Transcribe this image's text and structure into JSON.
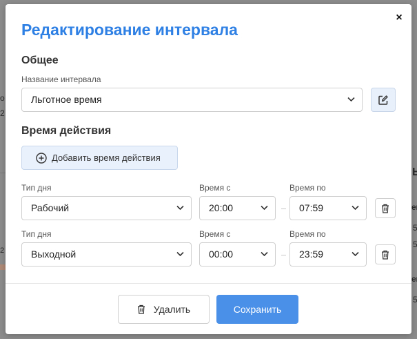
{
  "background": {
    "fragments": [
      "о",
      "2",
      "2",
      "Ь",
      "ем",
      "5",
      "5",
      "ем",
      "5"
    ]
  },
  "modal": {
    "title": "Редактирование интервала",
    "close_label": "×",
    "general": {
      "heading": "Общее",
      "name_label": "Название интервала",
      "name_value": "Льготное время"
    },
    "validity": {
      "heading": "Время действия",
      "add_label": "Добавить время действия",
      "rows": [
        {
          "day_type_label": "Тип дня",
          "day_type_value": "Рабочий",
          "time_from_label": "Время с",
          "time_from_value": "20:00",
          "time_to_label": "Время по",
          "time_to_value": "07:59"
        },
        {
          "day_type_label": "Тип дня",
          "day_type_value": "Выходной",
          "time_from_label": "Время с",
          "time_from_value": "00:00",
          "time_to_label": "Время по",
          "time_to_value": "23:59"
        }
      ]
    },
    "footer": {
      "delete_label": "Удалить",
      "save_label": "Сохранить"
    }
  },
  "colors": {
    "accent": "#2f80e4",
    "primary_button": "#4a90e8",
    "overlay": "#8d8d8d"
  },
  "icons": {
    "close": "close-icon",
    "edit": "edit-icon",
    "add": "plus-circle-icon",
    "delete": "trash-icon",
    "dropdown": "chevron-down-icon"
  }
}
